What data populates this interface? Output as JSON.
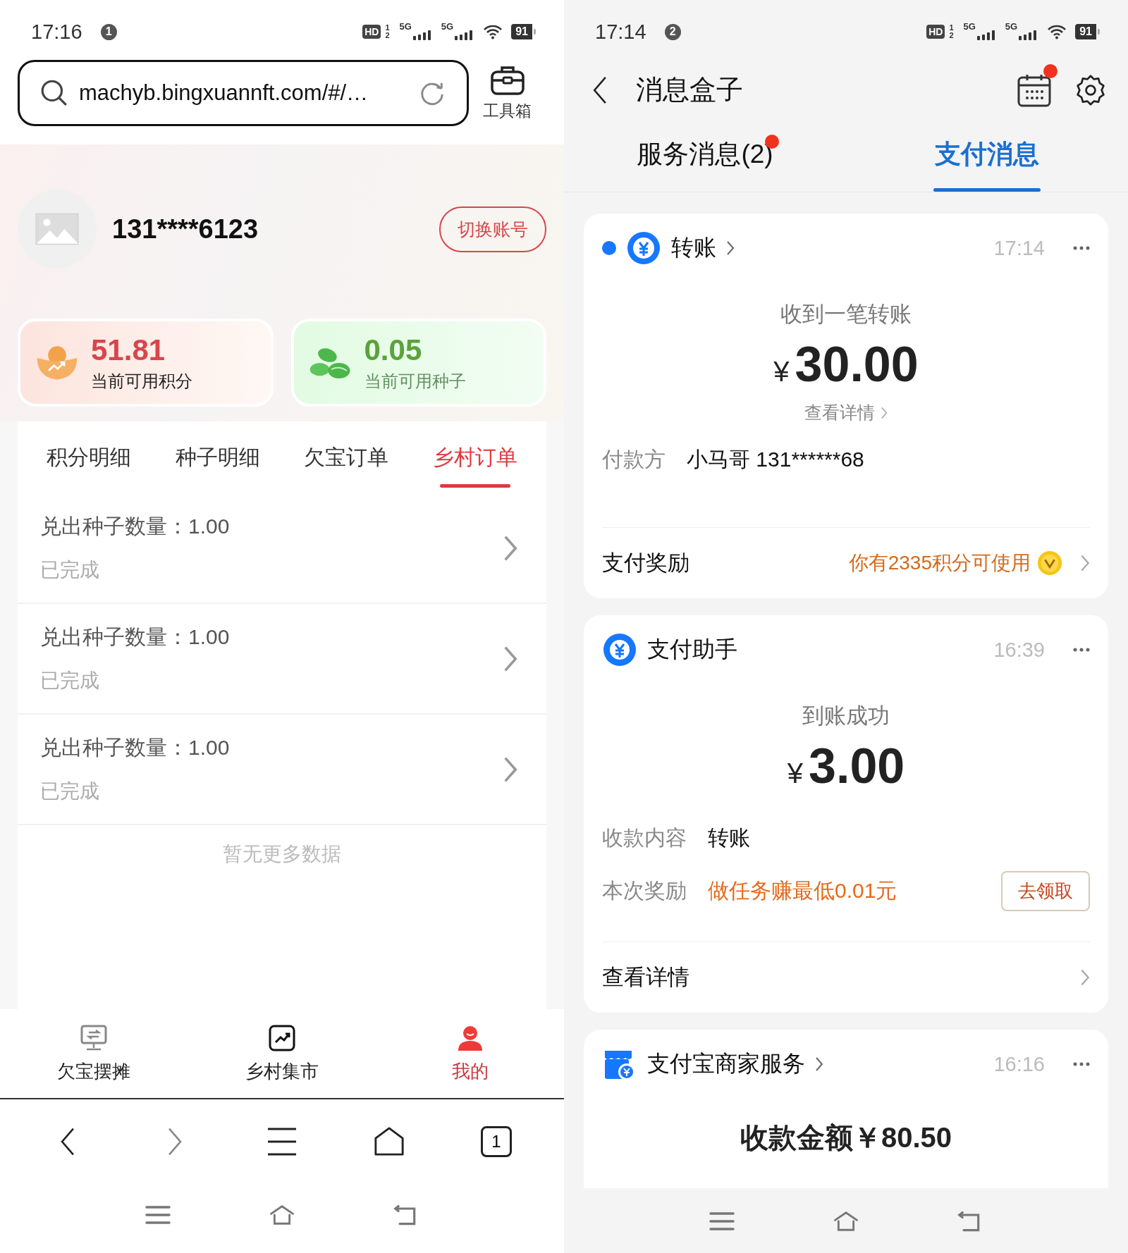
{
  "left_phone": {
    "status_bar": {
      "time": "17:16",
      "notification_count": "1",
      "hd": "HD",
      "sims": [
        "1",
        "2"
      ],
      "networks": [
        "5G",
        "5G"
      ],
      "battery": "91"
    },
    "address_bar": {
      "url": "machyb.bingxuannft.com/#/…"
    },
    "toolbox_label": "工具箱",
    "profile": {
      "phone": "131****6123",
      "switch_button": "切换账号"
    },
    "stats": [
      {
        "kind": "points",
        "value": "51.81",
        "label": "当前可用积分"
      },
      {
        "kind": "seeds",
        "value": "0.05",
        "label": "当前可用种子"
      }
    ],
    "tabs": [
      {
        "label": "积分明细",
        "selected": false
      },
      {
        "label": "种子明细",
        "selected": false
      },
      {
        "label": "欠宝订单",
        "selected": false
      },
      {
        "label": "乡村订单",
        "selected": true
      }
    ],
    "orders": [
      {
        "title": "兑出种子数量：1.00",
        "status": "已完成"
      },
      {
        "title": "兑出种子数量：1.00",
        "status": "已完成"
      },
      {
        "title": "兑出种子数量：1.00",
        "status": "已完成"
      }
    ],
    "empty_note": "暂无更多数据",
    "bottom_nav": [
      {
        "kind": "stall",
        "label": "欠宝摆摊",
        "selected": false
      },
      {
        "kind": "market",
        "label": "乡村集市",
        "selected": false
      },
      {
        "kind": "me",
        "label": "我的",
        "selected": true
      }
    ],
    "browser_toolbar": {
      "tab_count": "1"
    }
  },
  "right_phone": {
    "status_bar": {
      "time": "17:14",
      "notification_count": "2",
      "hd": "HD",
      "sims": [
        "1",
        "2"
      ],
      "networks": [
        "5G",
        "5G"
      ],
      "battery": "91"
    },
    "header": {
      "title": "消息盒子",
      "calendar_badge": true
    },
    "tabs": [
      {
        "label": "服务消息(2)",
        "selected": false,
        "badge": true
      },
      {
        "label": "支付消息",
        "selected": true,
        "badge": false
      }
    ],
    "cards": [
      {
        "kind": "transfer",
        "unread": true,
        "has_arrow": true,
        "sender": "转账",
        "time": "17:14",
        "headline": "收到一笔转账",
        "currency": "¥",
        "amount": "30.00",
        "detail_link": "查看详情",
        "fields": [
          {
            "label": "付款方",
            "value": "小马哥 131******68",
            "highlight": false
          }
        ],
        "reward": {
          "label": "支付奖励",
          "value": "你有2335积分可使用"
        }
      },
      {
        "kind": "assistant",
        "unread": false,
        "has_arrow": false,
        "sender": "支付助手",
        "time": "16:39",
        "headline": "到账成功",
        "currency": "¥",
        "amount": "3.00",
        "fields": [
          {
            "label": "收款内容",
            "value": "转账",
            "highlight": false
          },
          {
            "label": "本次奖励",
            "value": "做任务赚最低0.01元",
            "highlight": true,
            "button": "去领取"
          }
        ],
        "footer_link": "查看详情"
      },
      {
        "kind": "merchant",
        "unread": false,
        "has_arrow": true,
        "sender": "支付宝商家服务",
        "time": "16:16",
        "summary": "收款金额￥80.50"
      }
    ]
  }
}
